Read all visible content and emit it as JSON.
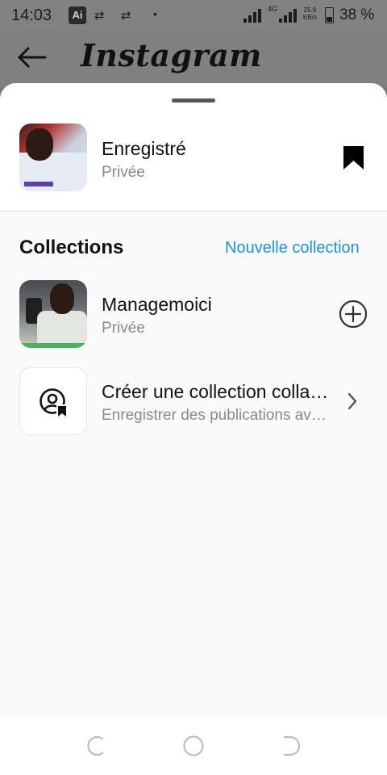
{
  "status": {
    "time": "14:03",
    "ai_badge": "Ai",
    "network": "4G",
    "speed_value": "25.9",
    "speed_unit": "KB/s",
    "battery": "38 %"
  },
  "header": {
    "brand": "Instagram",
    "back_icon": "back-arrow-icon"
  },
  "saved": {
    "title": "Enregistré",
    "privacy": "Privée",
    "icon": "bookmark-filled-icon"
  },
  "collections": {
    "heading": "Collections",
    "new_label": "Nouvelle collection",
    "items": [
      {
        "title": "Managemoici",
        "subtitle": "Privée",
        "action_icon": "add-circle-icon"
      },
      {
        "title": "Créer une collection collaborative",
        "subtitle": "Enregistrer des publications avec des amis",
        "action_icon": "chevron-right-icon"
      }
    ]
  },
  "colors": {
    "accent": "#1d8fe6",
    "sheet_bg": "#fafafa",
    "dim_bg": "#808080"
  }
}
